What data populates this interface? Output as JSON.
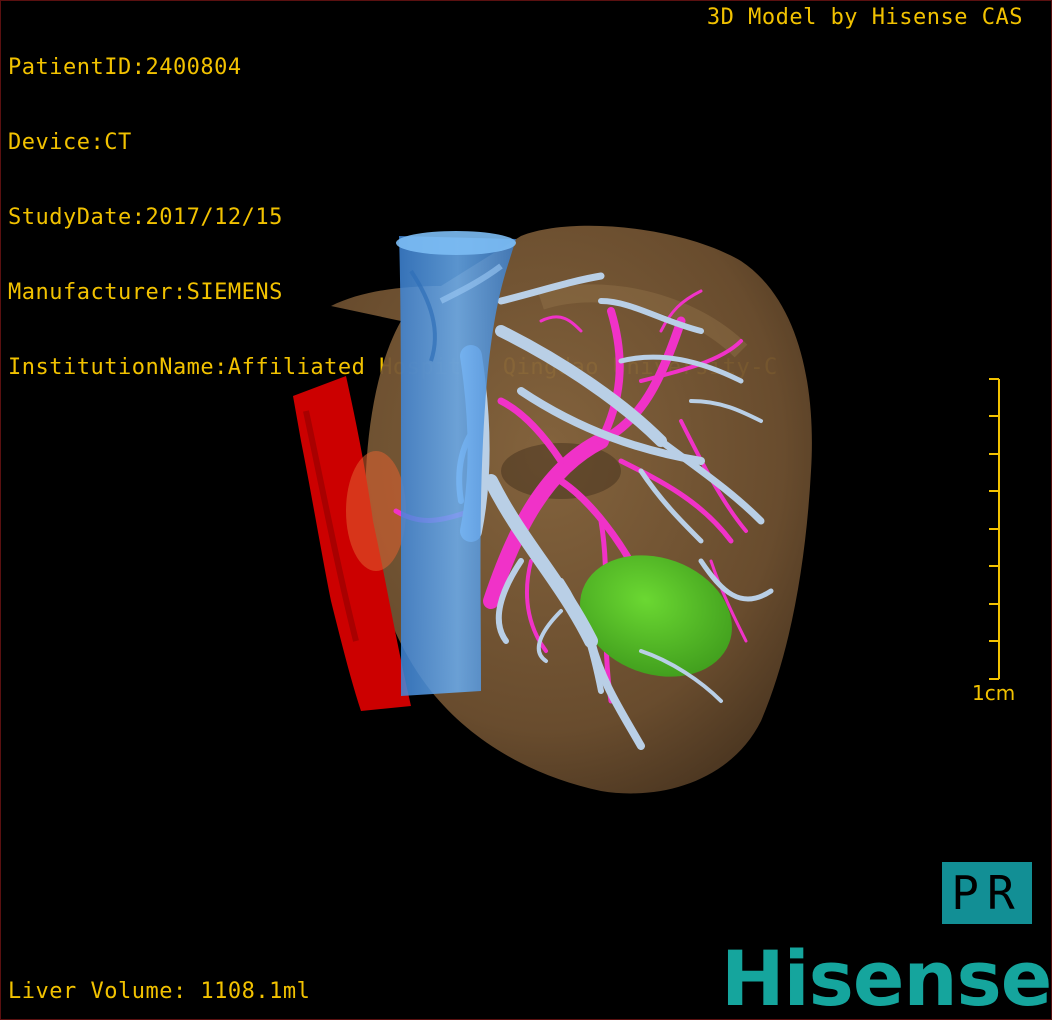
{
  "patient_info": {
    "patient_id": "PatientID:2400804",
    "device": "Device:CT",
    "study_date": "StudyDate:2017/12/15",
    "manufacturer": "Manufacturer:SIEMENS",
    "institution": "InstitutionName:Affiliated Hospital Qingdao University-C"
  },
  "brand_label": "3D Model by Hisense CAS",
  "liver_volume": "Liver Volume: 1108.1ml",
  "scale_bar": {
    "label": "1cm",
    "tick_count": 9
  },
  "orientation": "PR",
  "logo": "Hisense",
  "colors": {
    "overlay_text": "#f2c200",
    "liver": "#7a5a32",
    "vena_cava": "#4f9be6",
    "aorta": "#cc0000",
    "hepatic_veins": "#b9cfe6",
    "portal_vein": "#f032c8",
    "tumor": "#4fc021",
    "logo": "#15a59d",
    "orientation_box": "#128f95"
  },
  "model_structures": [
    "liver-surface",
    "inferior-vena-cava",
    "aorta",
    "hepatic-vein-tree",
    "portal-vein-tree",
    "liver-lesion"
  ]
}
